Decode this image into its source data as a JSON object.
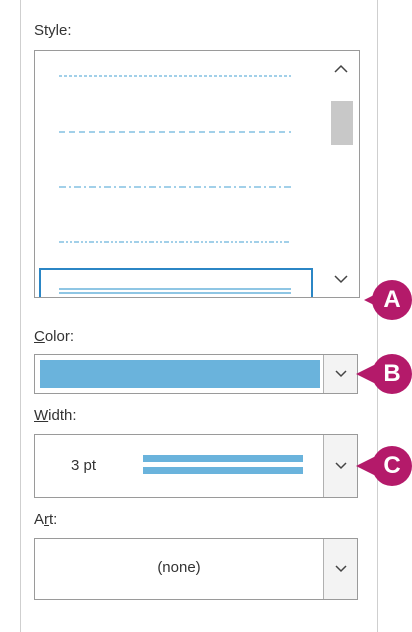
{
  "style": {
    "label": "Style:"
  },
  "color": {
    "label": "Color:",
    "swatch": "#6ab3dc"
  },
  "width": {
    "label": "Width:",
    "value": "3 pt"
  },
  "art": {
    "label": "Art:",
    "value": "(none)"
  },
  "callouts": {
    "a": "A",
    "b": "B",
    "c": "C"
  },
  "colors": {
    "accent": "#b41a6a",
    "line": "#6ab3dc",
    "selection": "#2b86c5"
  }
}
